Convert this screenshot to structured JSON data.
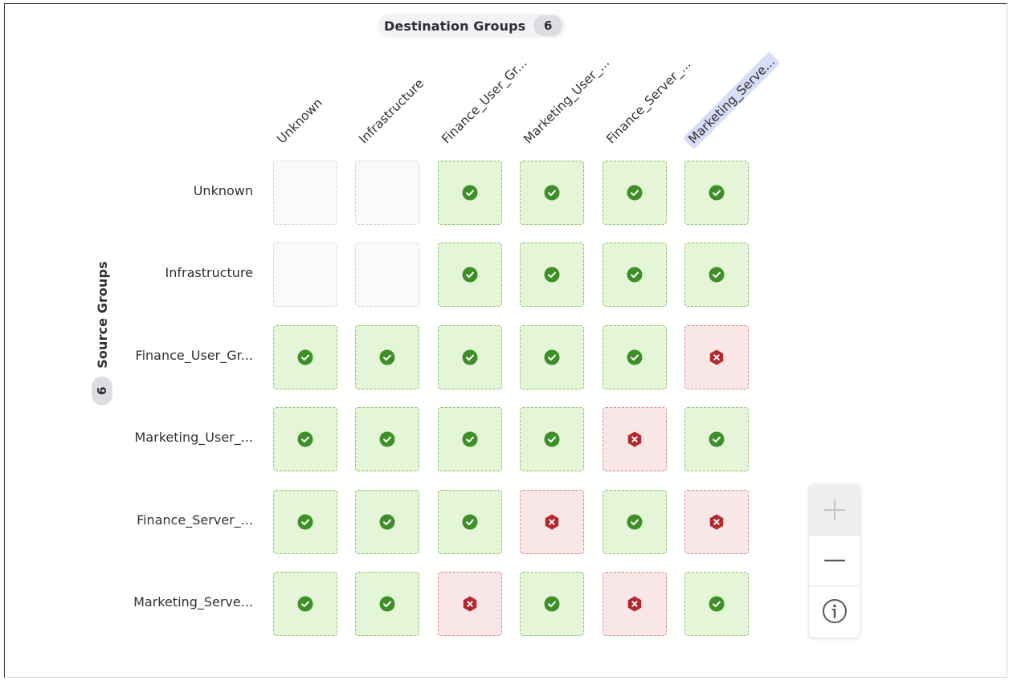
{
  "destination_header": {
    "title": "Destination Groups",
    "count": "6"
  },
  "source_header": {
    "title": "Source Groups",
    "count": "6"
  },
  "columns": [
    {
      "label": "Unknown",
      "highlighted": false
    },
    {
      "label": "Infrastructure",
      "highlighted": false
    },
    {
      "label": "Finance_User_Gr...",
      "highlighted": false
    },
    {
      "label": "Marketing_User_...",
      "highlighted": false
    },
    {
      "label": "Finance_Server_...",
      "highlighted": false
    },
    {
      "label": "Marketing_Serve...",
      "highlighted": true
    }
  ],
  "rows": [
    {
      "label": "Unknown",
      "cells": [
        "none",
        "none",
        "allow",
        "allow",
        "allow",
        "allow"
      ]
    },
    {
      "label": "Infrastructure",
      "cells": [
        "none",
        "none",
        "allow",
        "allow",
        "allow",
        "allow"
      ]
    },
    {
      "label": "Finance_User_Gr...",
      "cells": [
        "allow",
        "allow",
        "allow",
        "allow",
        "allow",
        "deny"
      ]
    },
    {
      "label": "Marketing_User_...",
      "cells": [
        "allow",
        "allow",
        "allow",
        "allow",
        "deny",
        "allow"
      ]
    },
    {
      "label": "Finance_Server_...",
      "cells": [
        "allow",
        "allow",
        "allow",
        "deny",
        "allow",
        "deny"
      ]
    },
    {
      "label": "Marketing_Serve...",
      "cells": [
        "allow",
        "allow",
        "deny",
        "allow",
        "deny",
        "allow"
      ]
    }
  ],
  "zoom_controls": {
    "zoom_in": {
      "icon": "plus-icon",
      "disabled": true
    },
    "zoom_out": {
      "icon": "minus-icon",
      "disabled": false
    },
    "info": {
      "icon": "info-icon"
    }
  },
  "colors": {
    "allow_fill": "#e4f5d8",
    "allow_icon": "#3f8f28",
    "deny_fill": "#f9e6e6",
    "deny_icon": "#b3282d",
    "highlight": "#d7dcf7"
  }
}
